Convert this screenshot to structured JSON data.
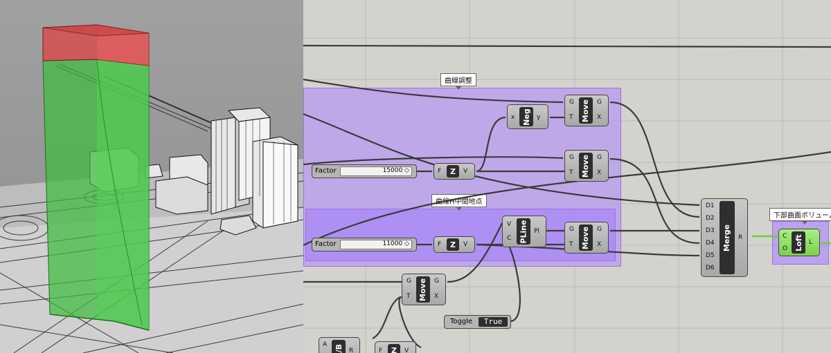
{
  "colors": {
    "group_fill": "#b89cf0",
    "group_border": "#a070e0",
    "wire": "#3a3a3a",
    "wire_green": "#6ad040",
    "viewport_volume": "#3fbd3f",
    "viewport_top": "#d94a4a"
  },
  "groups": [
    {
      "label": "曲線調整"
    },
    {
      "label": "曲線H中間地点"
    },
    {
      "label": "下部曲面ボリューム"
    }
  ],
  "sliders": [
    {
      "label": "Factor",
      "value": "15000 ◇"
    },
    {
      "label": "Factor",
      "value": "11000 ◇"
    }
  ],
  "toggle": {
    "label": "Toggle",
    "value": "True"
  },
  "components": {
    "neg": {
      "title": "Neg",
      "inputs": [
        "x"
      ],
      "outputs": [
        "y"
      ]
    },
    "move1": {
      "title": "Move",
      "inputs": [
        "G",
        "T"
      ],
      "outputs": [
        "G",
        "X"
      ]
    },
    "move2": {
      "title": "Move",
      "inputs": [
        "G",
        "T"
      ],
      "outputs": [
        "G",
        "X"
      ]
    },
    "move3": {
      "title": "Move",
      "inputs": [
        "G",
        "T"
      ],
      "outputs": [
        "G",
        "X"
      ]
    },
    "move4": {
      "title": "Move",
      "inputs": [
        "G",
        "T"
      ],
      "outputs": [
        "G",
        "X"
      ]
    },
    "z1": {
      "title": "Z",
      "inputs": [
        "F"
      ],
      "outputs": [
        "V"
      ]
    },
    "z2": {
      "title": "Z",
      "inputs": [
        "F"
      ],
      "outputs": [
        "V"
      ]
    },
    "z3": {
      "title": "Z",
      "inputs": [
        "F"
      ],
      "outputs": [
        "V"
      ]
    },
    "pline": {
      "title": "PLine",
      "inputs": [
        "V",
        "C"
      ],
      "outputs": [
        "Pl"
      ]
    },
    "merge": {
      "title": "Merge",
      "inputs": [
        "D1",
        "D2",
        "D3",
        "D4",
        "D5",
        "D6"
      ],
      "outputs": [
        "R"
      ]
    },
    "loft": {
      "title": "Loft",
      "inputs": [
        "C",
        "O"
      ],
      "outputs": [
        "L"
      ]
    },
    "ab": {
      "title": "A/B",
      "inputs": [
        "A"
      ],
      "outputs": [
        "R"
      ]
    }
  }
}
